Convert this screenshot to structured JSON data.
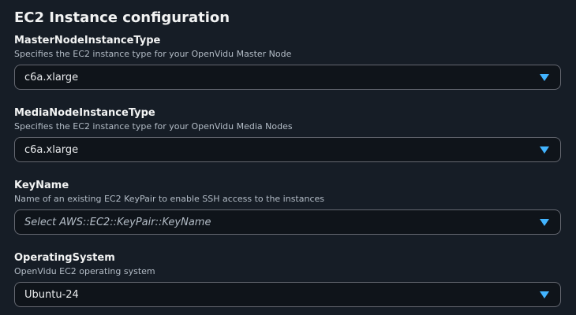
{
  "section": {
    "title": "EC2 Instance configuration"
  },
  "fields": [
    {
      "label": "MasterNodeInstanceType",
      "description": "Specifies the EC2 instance type for your OpenVidu Master Node",
      "value": "c6a.xlarge",
      "placeholder": ""
    },
    {
      "label": "MediaNodeInstanceType",
      "description": "Specifies the EC2 instance type for your OpenVidu Media Nodes",
      "value": "c6a.xlarge",
      "placeholder": ""
    },
    {
      "label": "KeyName",
      "description": "Name of an existing EC2 KeyPair to enable SSH access to the instances",
      "value": "",
      "placeholder": "Select AWS::EC2::KeyPair::KeyName"
    },
    {
      "label": "OperatingSystem",
      "description": "OpenVidu EC2 operating system",
      "value": "Ubuntu-24",
      "placeholder": ""
    }
  ],
  "colors": {
    "background": "#161d26",
    "select_background": "#0f141a",
    "select_border": "#656871",
    "caret": "#42b4ff"
  },
  "icons": {
    "caret": "caret-down-icon"
  }
}
